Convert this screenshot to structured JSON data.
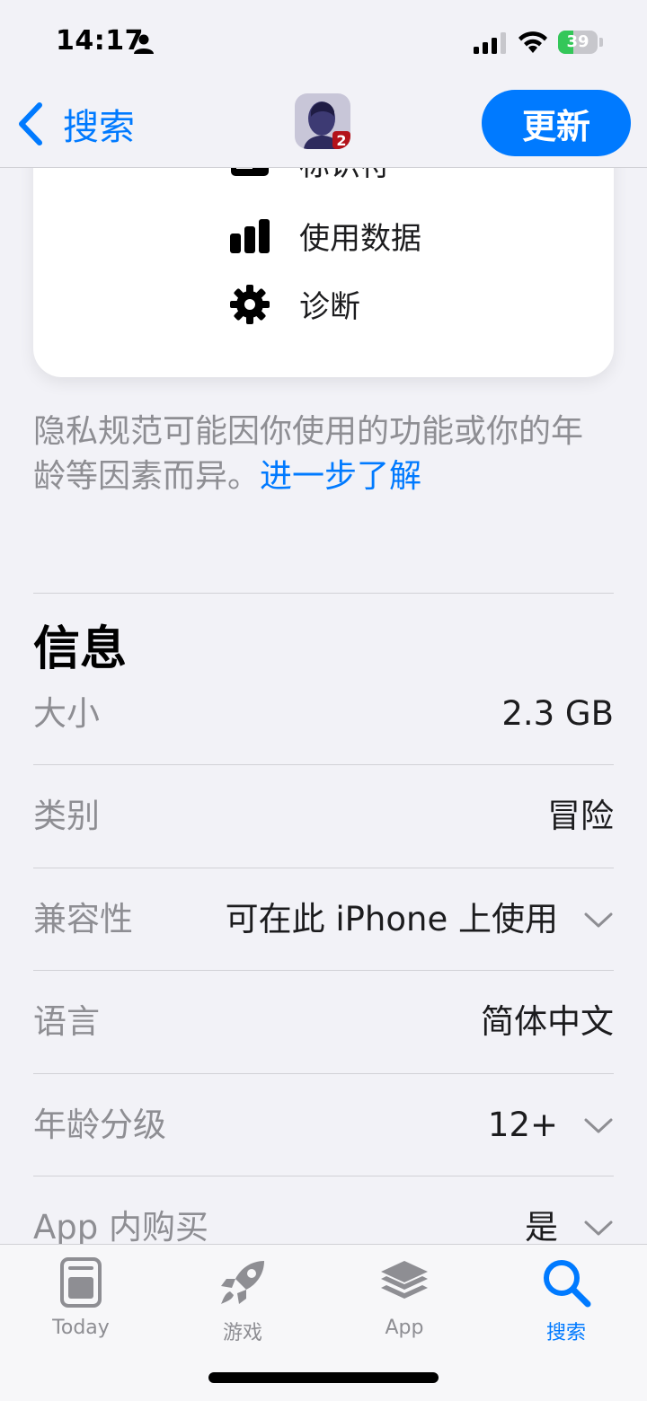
{
  "status_bar": {
    "time": "14:17",
    "battery": "39",
    "battery_level": 0.39
  },
  "nav": {
    "back_label": "搜索",
    "update_label": "更新",
    "app_icon_badge": "2"
  },
  "privacy_card": {
    "items": [
      {
        "label": "标识符",
        "icon": "id-card-icon"
      },
      {
        "label": "使用数据",
        "icon": "bar-chart-icon"
      },
      {
        "label": "诊断",
        "icon": "gear-icon"
      }
    ]
  },
  "privacy_note": {
    "text": "隐私规范可能因你使用的功能或你的年龄等因素而异。",
    "link": "进一步了解"
  },
  "info": {
    "title": "信息",
    "rows": [
      {
        "key": "大小",
        "value": "2.3 GB",
        "expandable": false
      },
      {
        "key": "类别",
        "value": "冒险",
        "expandable": false
      },
      {
        "key": "兼容性",
        "value": "可在此 iPhone 上使用",
        "expandable": true
      },
      {
        "key": "语言",
        "value": "简体中文",
        "expandable": false
      },
      {
        "key": "年龄分级",
        "value": "12+",
        "expandable": true
      },
      {
        "key": "App 内购买",
        "value": "是",
        "expandable": true
      }
    ]
  },
  "tabbar": {
    "tabs": [
      {
        "label": "Today",
        "icon": "today-icon",
        "active": false
      },
      {
        "label": "游戏",
        "icon": "rocket-icon",
        "active": false
      },
      {
        "label": "App",
        "icon": "layers-icon",
        "active": false
      },
      {
        "label": "搜索",
        "icon": "search-icon",
        "active": true
      }
    ]
  },
  "colors": {
    "accent": "#007aff",
    "battery": "#34c759",
    "secondary_text": "#8e8e93"
  }
}
